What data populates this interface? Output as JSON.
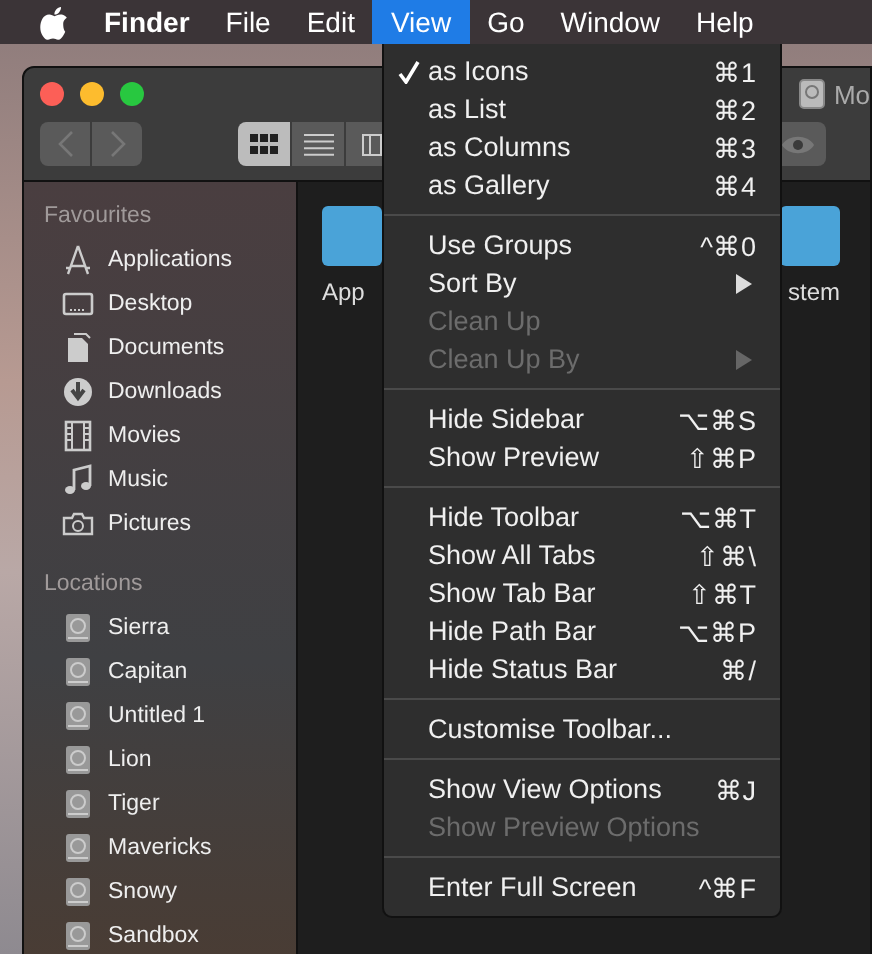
{
  "menubar": {
    "app": "Finder",
    "items": [
      {
        "label": "File",
        "selected": false
      },
      {
        "label": "Edit",
        "selected": false
      },
      {
        "label": "View",
        "selected": true
      },
      {
        "label": "Go",
        "selected": false
      },
      {
        "label": "Window",
        "selected": false
      },
      {
        "label": "Help",
        "selected": false
      }
    ]
  },
  "window": {
    "title": "Mo"
  },
  "view_buttons": [
    {
      "kind": "icons",
      "selected": true
    },
    {
      "kind": "list",
      "selected": false
    },
    {
      "kind": "columns",
      "selected": false
    }
  ],
  "sidebar": {
    "sections": [
      {
        "title": "Favourites",
        "items": [
          {
            "label": "Applications",
            "kind": "apps"
          },
          {
            "label": "Desktop",
            "kind": "desktop"
          },
          {
            "label": "Documents",
            "kind": "documents"
          },
          {
            "label": "Downloads",
            "kind": "downloads"
          },
          {
            "label": "Movies",
            "kind": "movies"
          },
          {
            "label": "Music",
            "kind": "music"
          },
          {
            "label": "Pictures",
            "kind": "pictures"
          }
        ]
      },
      {
        "title": "Locations",
        "items": [
          {
            "label": "Sierra",
            "kind": "disk"
          },
          {
            "label": "Capitan",
            "kind": "disk"
          },
          {
            "label": "Untitled 1",
            "kind": "disk"
          },
          {
            "label": "Lion",
            "kind": "disk"
          },
          {
            "label": "Tiger",
            "kind": "disk"
          },
          {
            "label": "Mavericks",
            "kind": "disk"
          },
          {
            "label": "Snowy",
            "kind": "disk"
          },
          {
            "label": "Sandbox",
            "kind": "disk"
          }
        ]
      }
    ]
  },
  "content": {
    "items": [
      {
        "label": "App"
      },
      {
        "label": "stem"
      }
    ]
  },
  "view_menu": [
    {
      "kind": "item",
      "label": "as Icons",
      "shortcut": "⌘1",
      "checked": true,
      "disabled": false,
      "submenu": false
    },
    {
      "kind": "item",
      "label": "as List",
      "shortcut": "⌘2",
      "checked": false,
      "disabled": false,
      "submenu": false
    },
    {
      "kind": "item",
      "label": "as Columns",
      "shortcut": "⌘3",
      "checked": false,
      "disabled": false,
      "submenu": false
    },
    {
      "kind": "item",
      "label": "as Gallery",
      "shortcut": "⌘4",
      "checked": false,
      "disabled": false,
      "submenu": false
    },
    {
      "kind": "separator"
    },
    {
      "kind": "item",
      "label": "Use Groups",
      "shortcut": "^⌘0",
      "checked": false,
      "disabled": false,
      "submenu": false
    },
    {
      "kind": "item",
      "label": "Sort By",
      "checked": false,
      "disabled": false,
      "submenu": true
    },
    {
      "kind": "item",
      "label": "Clean Up",
      "checked": false,
      "disabled": true,
      "submenu": false
    },
    {
      "kind": "item",
      "label": "Clean Up By",
      "checked": false,
      "disabled": true,
      "submenu": true
    },
    {
      "kind": "separator"
    },
    {
      "kind": "item",
      "label": "Hide Sidebar",
      "shortcut": "⌥⌘S",
      "checked": false,
      "disabled": false,
      "submenu": false
    },
    {
      "kind": "item",
      "label": "Show Preview",
      "shortcut": "⇧⌘P",
      "checked": false,
      "disabled": false,
      "submenu": false
    },
    {
      "kind": "separator"
    },
    {
      "kind": "item",
      "label": "Hide Toolbar",
      "shortcut": "⌥⌘T",
      "checked": false,
      "disabled": false,
      "submenu": false
    },
    {
      "kind": "item",
      "label": "Show All Tabs",
      "shortcut": "⇧⌘\\",
      "checked": false,
      "disabled": false,
      "submenu": false
    },
    {
      "kind": "item",
      "label": "Show Tab Bar",
      "shortcut": "⇧⌘T",
      "checked": false,
      "disabled": false,
      "submenu": false
    },
    {
      "kind": "item",
      "label": "Hide Path Bar",
      "shortcut": "⌥⌘P",
      "checked": false,
      "disabled": false,
      "submenu": false
    },
    {
      "kind": "item",
      "label": "Hide Status Bar",
      "shortcut": "⌘/",
      "checked": false,
      "disabled": false,
      "submenu": false
    },
    {
      "kind": "separator"
    },
    {
      "kind": "item",
      "label": "Customise Toolbar...",
      "checked": false,
      "disabled": false,
      "submenu": false
    },
    {
      "kind": "separator"
    },
    {
      "kind": "item",
      "label": "Show View Options",
      "shortcut": "⌘J",
      "checked": false,
      "disabled": false,
      "submenu": false
    },
    {
      "kind": "item",
      "label": "Show Preview Options",
      "checked": false,
      "disabled": true,
      "submenu": false
    },
    {
      "kind": "separator"
    },
    {
      "kind": "item",
      "label": "Enter Full Screen",
      "shortcut": "^⌘F",
      "checked": false,
      "disabled": false,
      "submenu": false
    }
  ]
}
